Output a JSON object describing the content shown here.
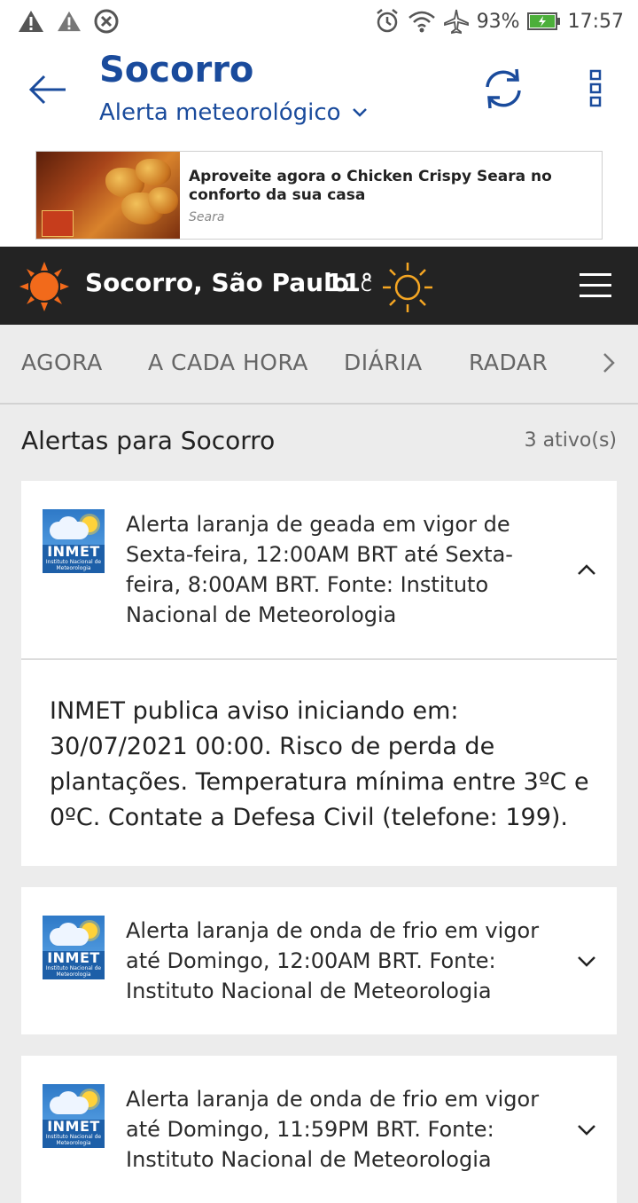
{
  "status_bar": {
    "battery": "93%",
    "time": "17:57",
    "icons": [
      "warning-icon",
      "warning-icon",
      "blocked-icon",
      "alarm-icon",
      "wifi-icon",
      "airplane-icon",
      "battery-icon"
    ]
  },
  "app_bar": {
    "title": "Socorro",
    "subtitle": "Alerta meteorológico",
    "accent_color": "#1a4b9c"
  },
  "ad": {
    "title": "Aproveite agora o Chicken Crispy Seara no conforto da sua casa",
    "source": "Seara"
  },
  "weather_bar": {
    "location": "Socorro, São Paulo",
    "temperature": "11°",
    "unit": "C"
  },
  "tabs": [
    "AGORA",
    "A CADA HORA",
    "DIÁRIA",
    "RADAR"
  ],
  "alerts_section": {
    "title": "Alertas para Socorro",
    "active_count": "3 ativo(s)"
  },
  "alerts": [
    {
      "logo_text": "INMET",
      "logo_subtext": "Instituto Nacional de Meteorologia",
      "summary": "Alerta laranja de geada em vigor de Sexta-feira, 12:00AM BRT até Sexta-feira, 8:00AM BRT. Fonte: Instituto Nacional de Meteorologia",
      "expanded": true,
      "detail": "INMET publica aviso iniciando em: 30/07/2021 00:00. Risco de perda de plantações. Temperatura mínima entre 3ºC e 0ºC. Contate a Defesa Civil (telefone: 199)."
    },
    {
      "logo_text": "INMET",
      "logo_subtext": "Instituto Nacional de Meteorologia",
      "summary": "Alerta laranja de onda de frio em vigor até Domingo, 12:00AM BRT. Fonte: Instituto Nacional de Meteorologia",
      "expanded": false
    },
    {
      "logo_text": "INMET",
      "logo_subtext": "Instituto Nacional de Meteorologia",
      "summary": "Alerta laranja de onda de frio em vigor até Domingo, 11:59PM BRT. Fonte: Instituto Nacional de Meteorologia",
      "expanded": false
    }
  ]
}
